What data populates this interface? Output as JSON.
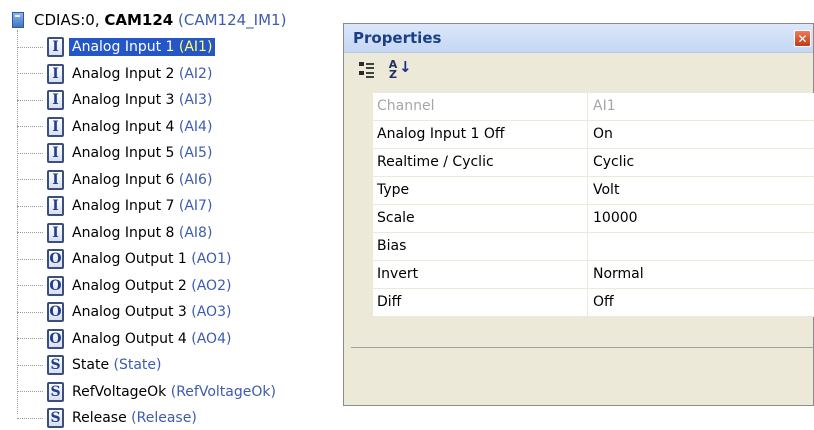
{
  "tree": {
    "root": {
      "prefix": "CDIAS:0, ",
      "name": "CAM124",
      "id": "(CAM124_IM1)"
    },
    "items": [
      {
        "type": "I",
        "label": "Analog Input 1",
        "id": "(AI1)",
        "selected": true
      },
      {
        "type": "I",
        "label": "Analog Input 2",
        "id": "(AI2)"
      },
      {
        "type": "I",
        "label": "Analog Input 3",
        "id": "(AI3)"
      },
      {
        "type": "I",
        "label": "Analog Input 4",
        "id": "(AI4)"
      },
      {
        "type": "I",
        "label": "Analog Input 5",
        "id": "(AI5)"
      },
      {
        "type": "I",
        "label": "Analog Input 6",
        "id": "(AI6)"
      },
      {
        "type": "I",
        "label": "Analog Input 7",
        "id": "(AI7)"
      },
      {
        "type": "I",
        "label": "Analog Input 8",
        "id": "(AI8)"
      },
      {
        "type": "O",
        "label": "Analog Output 1",
        "id": "(AO1)"
      },
      {
        "type": "O",
        "label": "Analog Output 2",
        "id": "(AO2)"
      },
      {
        "type": "O",
        "label": "Analog Output 3",
        "id": "(AO3)"
      },
      {
        "type": "O",
        "label": "Analog Output 4",
        "id": "(AO4)"
      },
      {
        "type": "S",
        "label": "State",
        "id": "(State)"
      },
      {
        "type": "S",
        "label": "RefVoltageOk",
        "id": "(RefVoltageOk)"
      },
      {
        "type": "S",
        "label": "Release",
        "id": "(Release)"
      }
    ]
  },
  "properties": {
    "title": "Properties",
    "close_glyph": "✕",
    "toolbar": {
      "categorized_icon": "categorized-icon",
      "alphabetical_icon": "sort-az-icon",
      "az_top": "A",
      "az_bottom": "Z",
      "arrow": "↓"
    },
    "rows": [
      {
        "name": "Channel",
        "value": "AI1",
        "disabled": true
      },
      {
        "name": "Analog Input 1 Off",
        "value": "On"
      },
      {
        "name": "Realtime / Cyclic",
        "value": "Cyclic"
      },
      {
        "name": "Type",
        "value": "Volt"
      },
      {
        "name": "Scale",
        "value": "10000"
      },
      {
        "name": "Bias",
        "value": ""
      },
      {
        "name": "Invert",
        "value": "Normal"
      },
      {
        "name": "Diff",
        "value": "Off"
      }
    ]
  },
  "colors": {
    "selection": "#2456c8",
    "id_text": "#3d5bb0",
    "title_text": "#1b3f86"
  }
}
